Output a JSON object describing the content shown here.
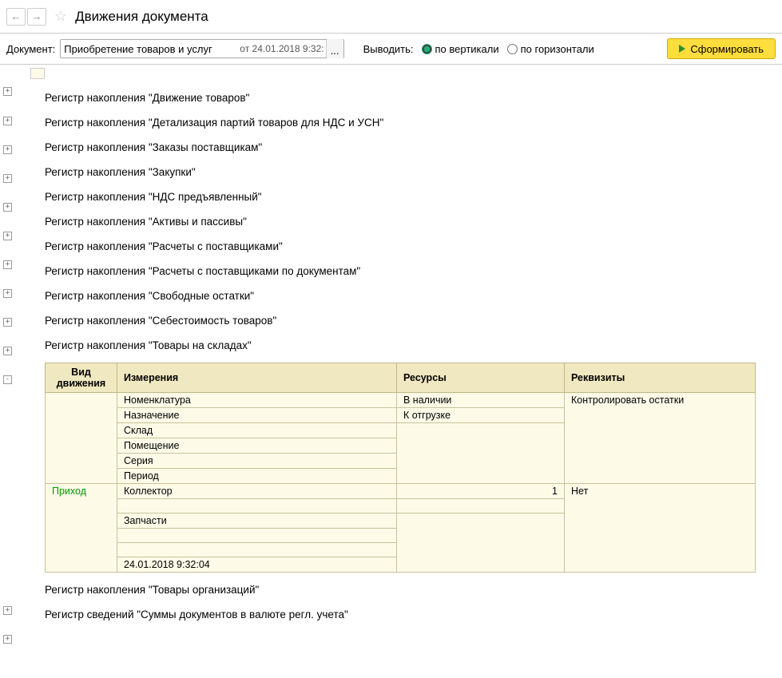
{
  "title": "Движения документа",
  "toolbar": {
    "doc_label": "Документ:",
    "doc_value": "Приобретение товаров и услуг",
    "date_text": "от 24.01.2018 9:32:",
    "output_label": "Выводить:",
    "radio_vertical": "по вертикали",
    "radio_horizontal": "по горизонтали",
    "generate_label": "Сформировать"
  },
  "registers": [
    "Регистр накопления \"Движение товаров\"",
    "Регистр накопления \"Детализация партий товаров для НДС и УСН\"",
    "Регистр накопления \"Заказы поставщикам\"",
    "Регистр накопления \"Закупки\"",
    "Регистр накопления \"НДС предъявленный\"",
    "Регистр накопления \"Активы и пассивы\"",
    "Регистр накопления \"Расчеты с поставщиками\"",
    "Регистр накопления \"Расчеты с поставщиками по документам\"",
    "Регистр накопления \"Свободные остатки\"",
    "Регистр накопления \"Себестоимость товаров\"",
    "Регистр накопления \"Товары на складах\"",
    "Регистр накопления \"Товары организаций\"",
    "Регистр сведений \"Суммы документов в валюте регл. учета\""
  ],
  "table": {
    "headers": {
      "vid": "Вид движения",
      "izm": "Измерения",
      "res": "Ресурсы",
      "req": "Реквизиты"
    },
    "group1": {
      "izm": [
        "Номенклатура",
        "Назначение",
        "Склад",
        "Помещение",
        "Серия",
        "Период"
      ],
      "res": [
        "В наличии",
        "К отгрузке"
      ],
      "req": [
        "Контролировать остатки"
      ]
    },
    "group2": {
      "vid": "Приход",
      "izm": [
        "Коллектор",
        "",
        "Запчасти",
        "",
        "",
        "24.01.2018 9:32:04"
      ],
      "res_num": "1",
      "req": "Нет"
    }
  }
}
